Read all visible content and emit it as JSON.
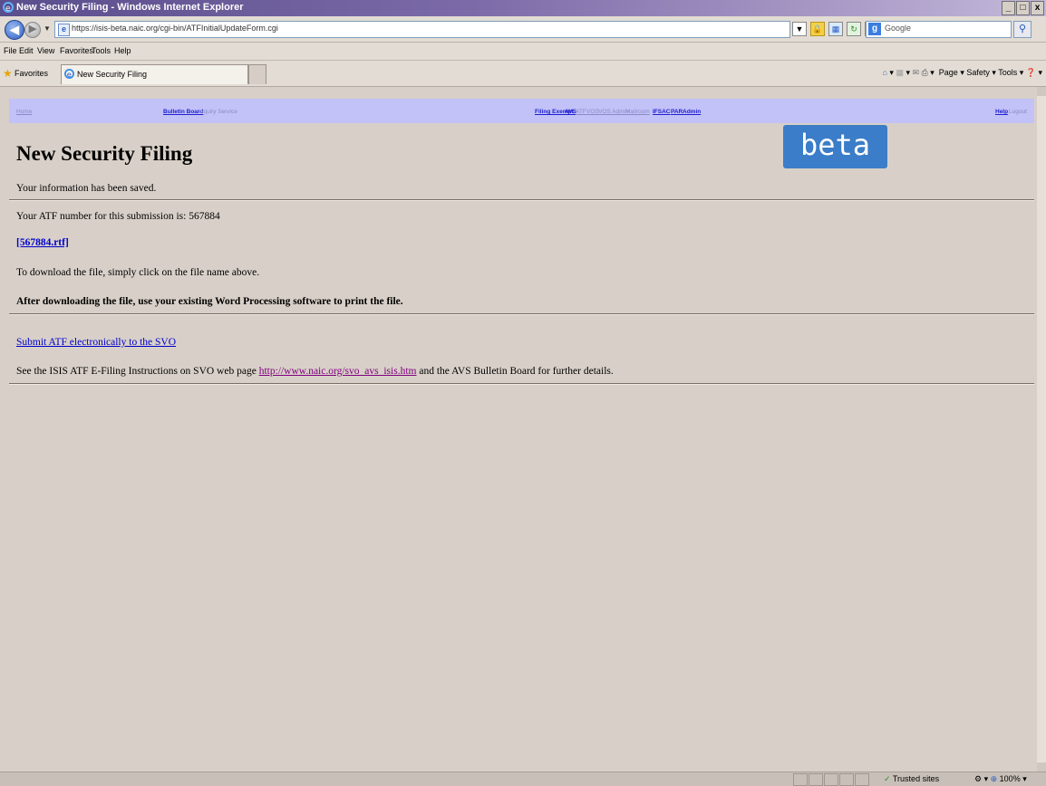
{
  "window": {
    "title": "New Security Filing - Windows Internet Explorer",
    "controls": [
      "_",
      "ř",
      "x"
    ]
  },
  "address": {
    "url": "https://isis-beta.naic.org/cgi-bin/ATFInitialUpdateForm.cgi",
    "search_placeholder": "Google"
  },
  "menu": {
    "items": [
      "File",
      "Edit",
      "View",
      "Favorites",
      "Tools",
      "Help"
    ]
  },
  "favorites": {
    "label": "Favorites",
    "tab_title": "New Security Filing",
    "command_bar": "Page ▾   Safety ▾   Tools ▾"
  },
  "nav": {
    "home": "Home",
    "bulletin_board": "Bulletin Board",
    "inquiry_service": "Inquiry Service",
    "filing_exempt": "Filing Exempt",
    "avs": "AVS",
    "atf": "ATF",
    "vos": "VOS",
    "vos_admin": "VOS Admin",
    "mailroom": "Mailroom",
    "ifsac": "IFSAC",
    "par": "PAR",
    "admin": "Admin",
    "help": "Help",
    "logout": "Logout"
  },
  "page": {
    "title": "New Security Filing",
    "beta_badge": "beta",
    "saved_msg": "Your information has been saved.",
    "atf_msg": "Your ATF number for this submission is: 567884",
    "file_link": "[567884.rtf]",
    "download_msg": "To download the file, simply click on the file name above.",
    "print_msg": "After downloading the file, use your existing Word Processing software to print the file.",
    "submit_link": "Submit ATF electronically to the SVO",
    "instructions_prefix": "See the ISIS ATF E-Filing Instructions on SVO web page",
    "instructions_url": "http://www.naic.org/svo_avs_isis.htm",
    "instructions_suffix": "and the AVS Bulletin Board for further details."
  },
  "status": {
    "zone": "Trusted sites",
    "zoom": "100%"
  }
}
